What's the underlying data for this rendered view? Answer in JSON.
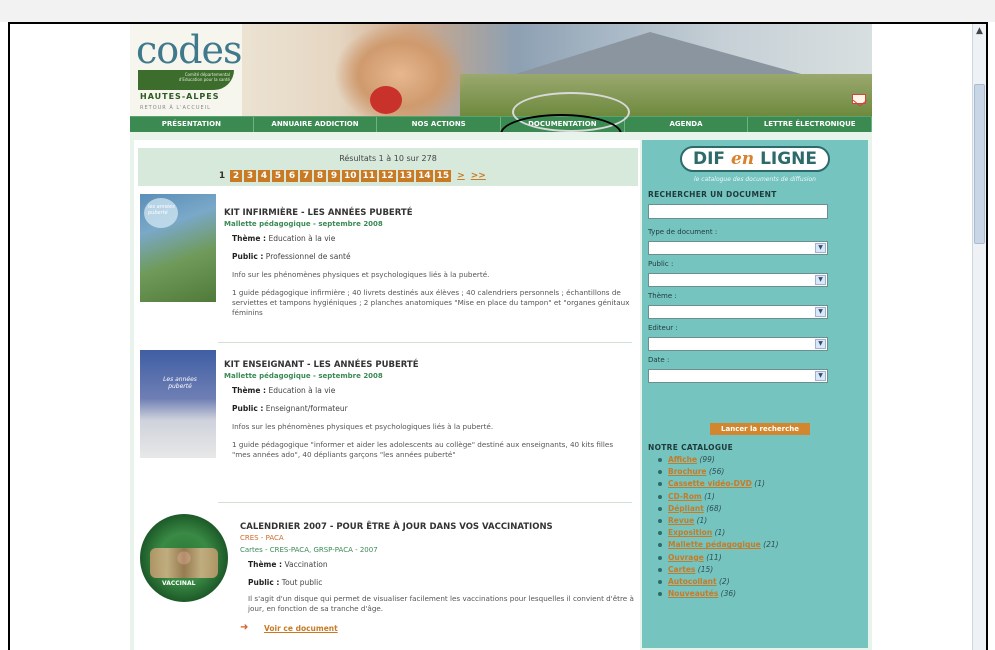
{
  "site": {
    "logo_text": "codes",
    "logo_small": "Comité départemental d'Education pour la santé",
    "logo_region": "HAUTES-ALPES",
    "logo_back": "RETOUR À L'ACCUEIL"
  },
  "nav": {
    "items": [
      {
        "label": "PRÉSENTATION"
      },
      {
        "label": "ANNUAIRE ADDICTION"
      },
      {
        "label": "NOS ACTIONS"
      },
      {
        "label": "DOCUMENTATION"
      },
      {
        "label": "AGENDA"
      },
      {
        "label": "LETTRE ÉLECTRONIQUE"
      }
    ]
  },
  "results": {
    "summary": "Résultats 1 à 10 sur 278",
    "current_page": "1",
    "pages": [
      "2",
      "3",
      "4",
      "5",
      "6",
      "7",
      "8",
      "9",
      "10",
      "11",
      "12",
      "13",
      "14",
      "15"
    ],
    "next": ">",
    "next_block": ">>"
  },
  "items": [
    {
      "title": "KIT INFIRMIÈRE - LES ANNÉES PUBERTÉ",
      "subtitle": "Mallette pédagogique - septembre 2008",
      "theme_label": "Thème :",
      "theme": "Education à la vie",
      "public_label": "Public :",
      "public": "Professionnel de santé",
      "summary": "Info sur les phénomènes physiques et psychologiques liés à la puberté.",
      "contents": "1 guide pédagogique infirmière ; 40 livrets destinés aux élèves ; 40 calendriers personnels ; échantillons de serviettes et tampons hygiéniques ; 2 planches anatomiques \"Mise en place du tampon\" et \"organes génitaux féminins",
      "thumb_text": "les années puberté"
    },
    {
      "title": "KIT ENSEIGNANT - LES ANNÉES PUBERTÉ",
      "subtitle": "Mallette pédagogique - septembre 2008",
      "theme_label": "Thème :",
      "theme": "Education à la vie",
      "public_label": "Public :",
      "public": "Enseignant/formateur",
      "summary": "Infos sur les phénomènes physiques et psychologiques liés à la puberté.",
      "contents": "1 guide pédagogique \"informer et aider les adolescents au collège\" destiné aux enseignants, 40 kits filles \"mes années ado\", 40 dépliants garçons \"les années puberté\"",
      "thumb_text": "Les années puberté"
    },
    {
      "title": "CALENDRIER 2007 - POUR ÊTRE À JOUR DANS VOS VACCINATIONS",
      "subtitle_1": "CRES - PACA",
      "subtitle_2": "Cartes - CRES-PACA, GRSP-PACA - 2007",
      "theme_label": "Thème :",
      "theme": "Vaccination",
      "public_label": "Public :",
      "public": "Tout public",
      "summary": "Il s'agit d'un disque qui permet de visualiser facilement les vaccinations pour lesquelles il convient d'être à jour, en fonction de sa tranche d'âge.",
      "thumb_text": "VACCINAL",
      "view_link": "Voir ce document"
    }
  ],
  "sidebar": {
    "logo_dif": "DIF",
    "logo_en": "en",
    "logo_ligne": "LIGNE",
    "tagline": "le catalogue des documents de diffusion",
    "search_title": "RECHERCHER UN DOCUMENT",
    "labels": {
      "type": "Type de document :",
      "public": "Public :",
      "theme": "Thème :",
      "editor": "Editeur :",
      "date": "Date :"
    },
    "search_button": "Lancer la recherche",
    "catalog_title": "NOTRE CATALOGUE",
    "catalog": [
      {
        "label": "Affiche",
        "count": "(99)"
      },
      {
        "label": "Brochure",
        "count": "(56)"
      },
      {
        "label": "Cassette vidéo-DVD",
        "count": "(1)"
      },
      {
        "label": "CD-Rom",
        "count": "(1)"
      },
      {
        "label": "Dépliant",
        "count": "(68)"
      },
      {
        "label": "Revue",
        "count": "(1)"
      },
      {
        "label": "Exposition",
        "count": "(1)"
      },
      {
        "label": "Mallette pédagogique",
        "count": "(21)"
      },
      {
        "label": "Ouvrage",
        "count": "(11)"
      },
      {
        "label": "Cartes",
        "count": "(15)"
      },
      {
        "label": "Autocollant",
        "count": "(2)"
      },
      {
        "label": "Nouveautés",
        "count": "(36)"
      }
    ]
  }
}
